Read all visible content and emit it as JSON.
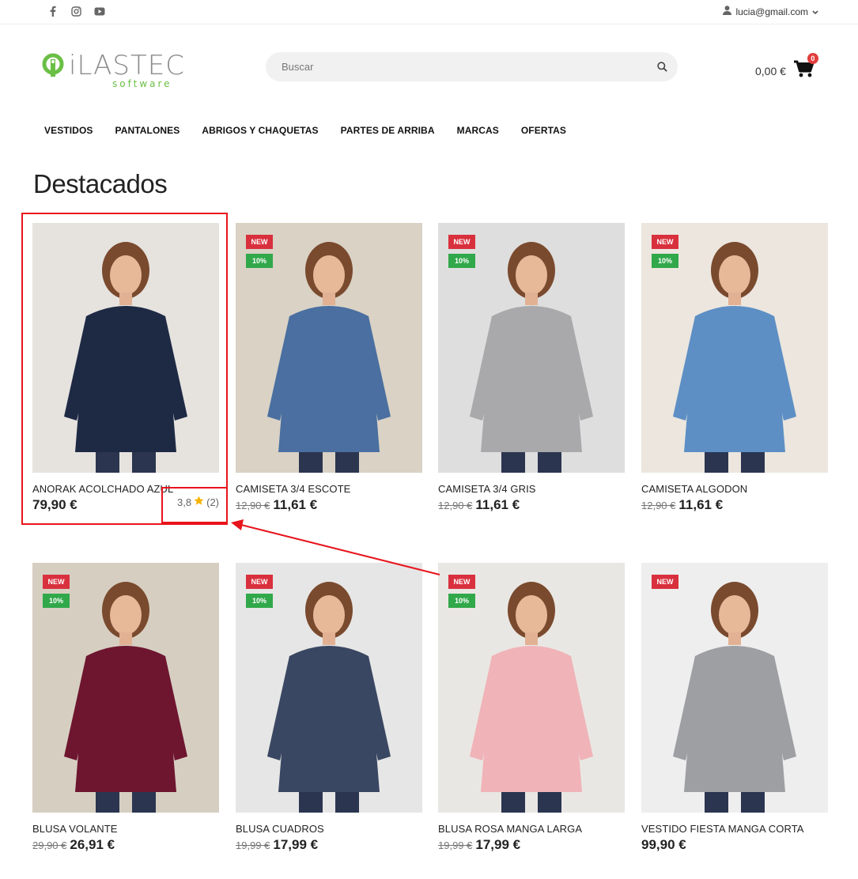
{
  "topbar": {
    "social": [
      "facebook-icon",
      "instagram-icon",
      "youtube-icon"
    ],
    "account_email": "lucia@gmail.com"
  },
  "logo": {
    "main": "iLASTEC",
    "sub": "software"
  },
  "search": {
    "placeholder": "Buscar"
  },
  "cart": {
    "total": "0,00 €",
    "count": "0"
  },
  "nav": [
    "VESTIDOS",
    "PANTALONES",
    "ABRIGOS Y CHAQUETAS",
    "PARTES DE ARRIBA",
    "MARCAS",
    "OFERTAS"
  ],
  "section_title": "Destacados",
  "products": [
    {
      "name": "ANORAK ACOLCHADO AZUL",
      "old_price": "",
      "price": "79,90 €",
      "badge_new": "",
      "badge_off": "",
      "rating": "3,8",
      "reviews": "(2)",
      "garment": "#1e2a44"
    },
    {
      "name": "CAMISETA 3/4 ESCOTE",
      "old_price": "12,90 €",
      "price": "11,61 €",
      "badge_new": "NEW",
      "badge_off": "10%",
      "garment": "#4a6fa0"
    },
    {
      "name": "CAMISETA 3/4 GRIS",
      "old_price": "12,90 €",
      "price": "11,61 €",
      "badge_new": "NEW",
      "badge_off": "10%",
      "garment": "#a9a9ab"
    },
    {
      "name": "CAMISETA ALGODON",
      "old_price": "12,90 €",
      "price": "11,61 €",
      "badge_new": "NEW",
      "badge_off": "10%",
      "garment": "#5d8fc4"
    },
    {
      "name": "BLUSA VOLANTE",
      "old_price": "29,90 €",
      "price": "26,91 €",
      "badge_new": "NEW",
      "badge_off": "10%",
      "garment": "#6e1530"
    },
    {
      "name": "BLUSA CUADROS",
      "old_price": "19,99 €",
      "price": "17,99 €",
      "badge_new": "NEW",
      "badge_off": "10%",
      "garment": "#3a4762"
    },
    {
      "name": "BLUSA ROSA MANGA LARGA",
      "old_price": "19,99 €",
      "price": "17,99 €",
      "badge_new": "NEW",
      "badge_off": "10%",
      "garment": "#f0b3b8"
    },
    {
      "name": "VESTIDO FIESTA MANGA CORTA",
      "old_price": "",
      "price": "99,90 €",
      "badge_new": "NEW",
      "badge_off": "",
      "garment": "#9d9fa3"
    }
  ],
  "colors": {
    "badge_new": "#d9303e",
    "badge_off": "#31a84a",
    "annotation": "#e8141b",
    "star": "#f5b301"
  }
}
